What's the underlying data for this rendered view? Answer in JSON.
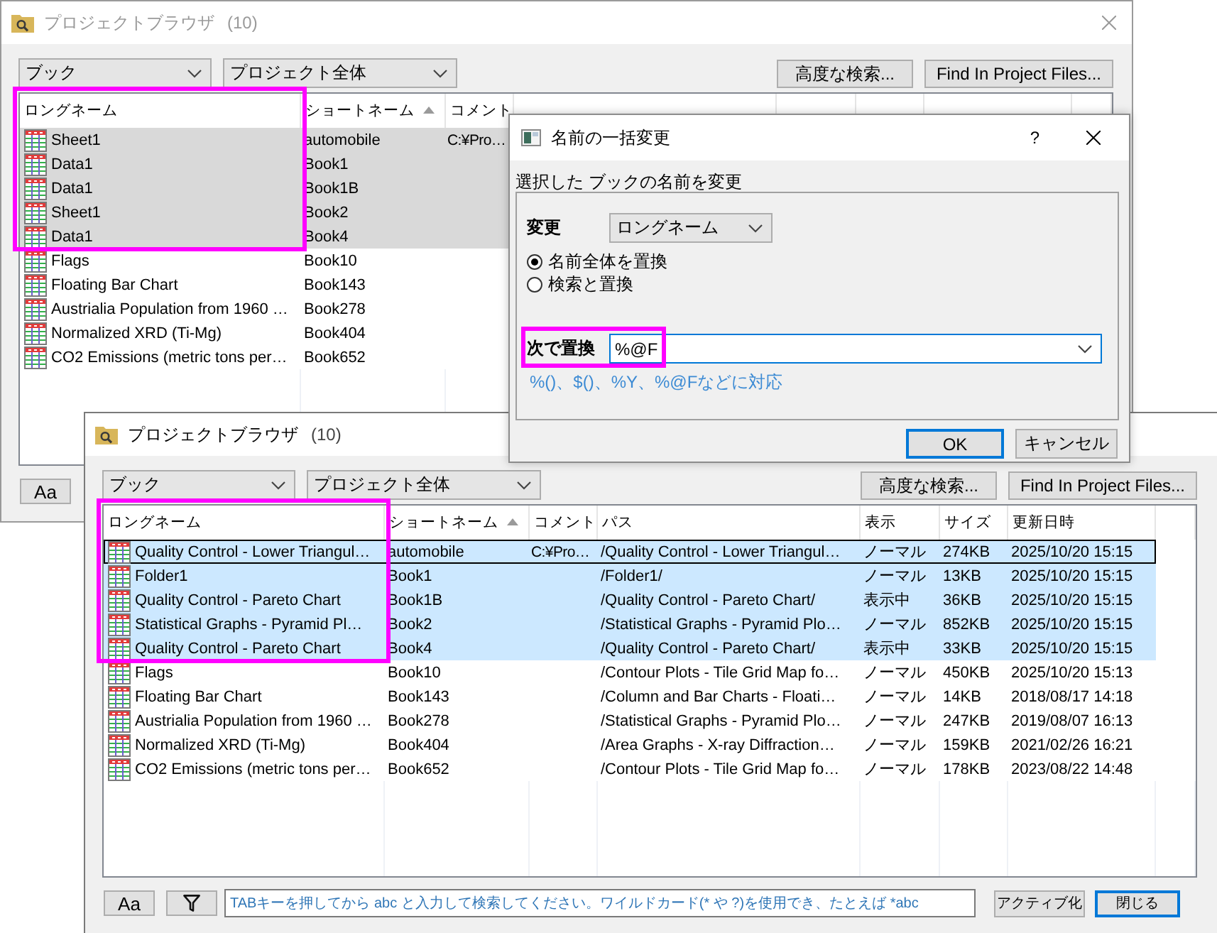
{
  "windows": [
    {
      "title": "プロジェクトブラウザ",
      "count": "(10)",
      "active": false,
      "filters": [
        {
          "value": "ブック"
        },
        {
          "value": "プロジェクト全体"
        }
      ],
      "buttons": [
        "高度な検索...",
        "Find In Project Files..."
      ],
      "table": {
        "columns": [
          {
            "label": "ロングネーム",
            "highlighted": true,
            "sorted": false
          },
          {
            "label": "ショートネーム",
            "highlighted": false,
            "sorted": true
          },
          {
            "label": "コメント",
            "highlighted": false,
            "sorted": false
          }
        ],
        "rows": [
          {
            "long_name": "Sheet1",
            "short_name": "automobile",
            "comment": "C:¥Pro…",
            "selected": true
          },
          {
            "long_name": "Data1",
            "short_name": "Book1",
            "selected": true
          },
          {
            "long_name": "Data1",
            "short_name": "Book1B",
            "selected": true
          },
          {
            "long_name": "Sheet1",
            "short_name": "Book2",
            "selected": true
          },
          {
            "long_name": "Data1",
            "short_name": "Book4",
            "selected": true
          },
          {
            "long_name": "Flags",
            "short_name": "Book10",
            "selected": false
          },
          {
            "long_name": "Floating Bar Chart",
            "short_name": "Book143",
            "selected": false
          },
          {
            "long_name": "Austrialia Population from 1960 …",
            "short_name": "Book278",
            "selected": false
          },
          {
            "long_name": "Normalized XRD (Ti-Mg)",
            "short_name": "Book404",
            "selected": false
          },
          {
            "long_name": "CO2 Emissions (metric tons per…",
            "short_name": "Book652",
            "selected": false
          }
        ]
      },
      "footer": {
        "tools": [
          {
            "kind": "text",
            "label": "Aa"
          }
        ]
      }
    },
    {
      "title": "プロジェクトブラウザ",
      "count": "(10)",
      "active": true,
      "filters": [
        {
          "value": "ブック"
        },
        {
          "value": "プロジェクト全体"
        }
      ],
      "buttons": [
        "高度な検索...",
        "Find In Project Files..."
      ],
      "table": {
        "columns": [
          {
            "label": "ロングネーム",
            "highlighted": true,
            "sorted": false
          },
          {
            "label": "ショートネーム",
            "highlighted": false,
            "sorted": true
          },
          {
            "label": "コメント",
            "highlighted": false,
            "sorted": false
          },
          {
            "label": "パス",
            "highlighted": false,
            "sorted": false
          },
          {
            "label": "表示",
            "highlighted": false,
            "sorted": false
          },
          {
            "label": "サイズ",
            "highlighted": false,
            "sorted": false
          },
          {
            "label": "更新日時",
            "highlighted": false,
            "sorted": false
          }
        ],
        "rows": [
          {
            "long_name": "Quality Control - Lower Triangul…",
            "short_name": "automobile",
            "comment": "C:¥Pro…",
            "path": "/Quality Control - Lower Triangul…",
            "view": "ノーマル",
            "size": "274KB",
            "modified": "2025/10/20 15:15",
            "selected": true,
            "focused": true
          },
          {
            "long_name": "Folder1",
            "short_name": "Book1",
            "path": "/Folder1/",
            "view": "ノーマル",
            "size": "13KB",
            "modified": "2025/10/20 15:15",
            "selected": true,
            "focused": false
          },
          {
            "long_name": "Quality Control - Pareto Chart",
            "short_name": "Book1B",
            "path": "/Quality Control - Pareto Chart/",
            "view": "表示中",
            "size": "36KB",
            "modified": "2025/10/20 15:15",
            "selected": true,
            "focused": false
          },
          {
            "long_name": "Statistical Graphs - Pyramid Pl…",
            "short_name": "Book2",
            "path": "/Statistical Graphs - Pyramid Plo…",
            "view": "ノーマル",
            "size": "852KB",
            "modified": "2025/10/20 15:15",
            "selected": true,
            "focused": false
          },
          {
            "long_name": "Quality Control - Pareto Chart",
            "short_name": "Book4",
            "path": "/Quality Control - Pareto Chart/",
            "view": "表示中",
            "size": "33KB",
            "modified": "2025/10/20 15:15",
            "selected": true,
            "focused": false
          },
          {
            "long_name": "Flags",
            "short_name": "Book10",
            "path": "/Contour Plots - Tile Grid Map fo…",
            "view": "ノーマル",
            "size": "450KB",
            "modified": "2025/10/20 15:13",
            "selected": false,
            "focused": false
          },
          {
            "long_name": "Floating Bar Chart",
            "short_name": "Book143",
            "path": "/Column and Bar Charts - Floati…",
            "view": "ノーマル",
            "size": "14KB",
            "modified": "2018/08/17 14:18",
            "selected": false,
            "focused": false
          },
          {
            "long_name": "Austrialia Population from 1960 …",
            "short_name": "Book278",
            "path": "/Statistical Graphs - Pyramid Plo…",
            "view": "ノーマル",
            "size": "247KB",
            "modified": "2019/08/07 16:13",
            "selected": false,
            "focused": false
          },
          {
            "long_name": "Normalized XRD (Ti-Mg)",
            "short_name": "Book404",
            "path": "/Area Graphs - X-ray Diffraction…",
            "view": "ノーマル",
            "size": "159KB",
            "modified": "2021/02/26 16:21",
            "selected": false,
            "focused": false
          },
          {
            "long_name": "CO2 Emissions (metric tons per…",
            "short_name": "Book652",
            "path": "/Contour Plots - Tile Grid Map fo…",
            "view": "ノーマル",
            "size": "178KB",
            "modified": "2023/08/22 14:48",
            "selected": false,
            "focused": false
          }
        ]
      },
      "footer": {
        "tools": [
          {
            "kind": "text",
            "label": "Aa"
          },
          {
            "kind": "filter"
          }
        ],
        "search": {
          "placeholder": "TABキーを押してから abc と入力して検索してください。ワイルドカード(* や ?)を使用でき、たとえば *abc"
        },
        "buttons": [
          {
            "label": "アクティブ化",
            "default": false
          },
          {
            "label": "閉じる",
            "default": true
          }
        ]
      }
    }
  ],
  "dialog": {
    "title": "名前の一括変更",
    "help": "?",
    "instruction": "選択した ブックの名前を変更",
    "target": {
      "label": "変更",
      "value": "ロングネーム"
    },
    "modes": [
      {
        "label": "名前全体を置換",
        "selected": true
      },
      {
        "label": "検索と置換",
        "selected": false
      }
    ],
    "replace": {
      "label": "次で置換",
      "value": "%@F",
      "highlighted": true,
      "hint": "%()、$()、%Y、%@Fなどに対応"
    },
    "buttons": [
      {
        "label": "OK",
        "default": true
      },
      {
        "label": "キャンセル",
        "default": false
      }
    ]
  }
}
